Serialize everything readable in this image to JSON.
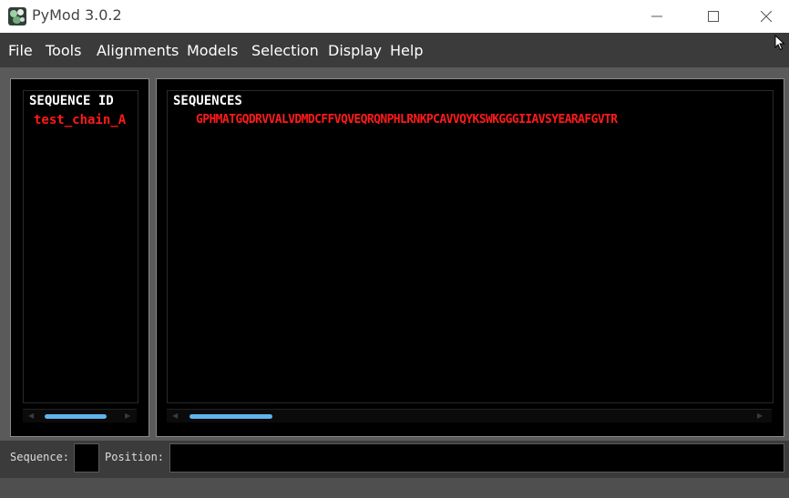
{
  "window": {
    "title": "PyMod 3.0.2"
  },
  "menu": {
    "items": [
      "File",
      "Tools",
      "Alignments",
      "Models",
      "Selection",
      "Display",
      "Help"
    ]
  },
  "left_panel": {
    "header": "SEQUENCE ID",
    "entries": [
      "test_chain_A"
    ]
  },
  "right_panel": {
    "header": "SEQUENCES",
    "sequences": [
      "GPHMATGQDRVVALVDMDCFFVQVEQRQNPHLRNKPCAVVQYKSWKGGGIIAVSYEARAFGVTR"
    ]
  },
  "status": {
    "sequence_label": "Sequence:",
    "sequence_value": "",
    "position_label": "Position:",
    "position_value": ""
  },
  "colors": {
    "sequence_text": "#ff1a1a",
    "scroll_thumb": "#5fb4ee",
    "background": "#000000"
  },
  "icons": [
    "pymod-app-icon",
    "minimize-icon",
    "maximize-icon",
    "close-icon",
    "mouse-cursor-icon"
  ]
}
